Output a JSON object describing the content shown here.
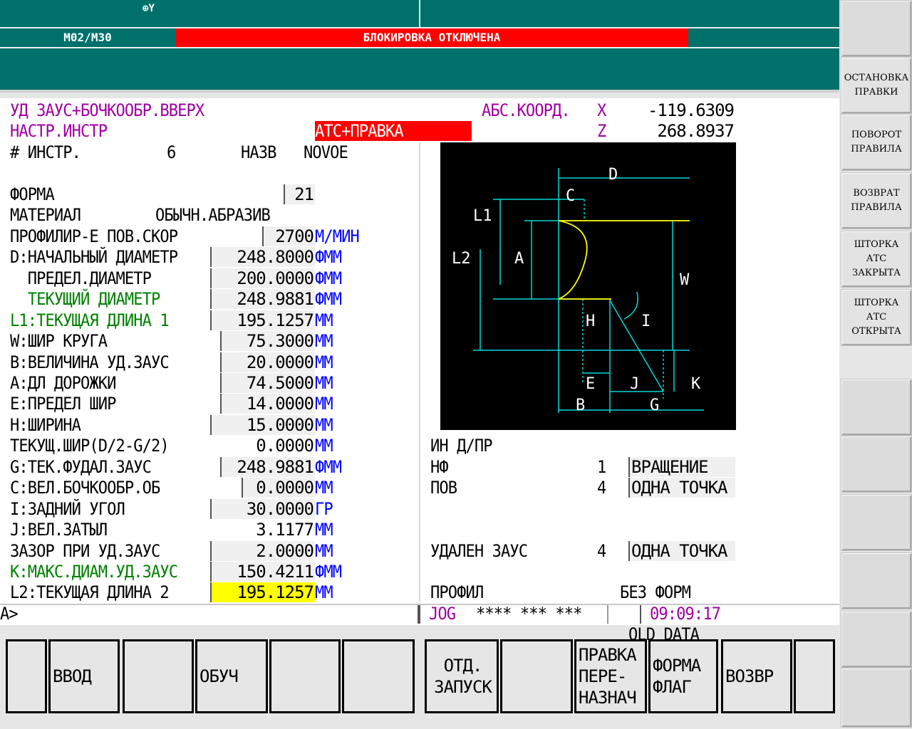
{
  "header": {
    "axis_indicator": "Y",
    "mode": "M02/M30",
    "lock_status": "БЛОКИРОВКА ОТКЛЮЧЕНА"
  },
  "info": {
    "line1": "УД ЗАУС+БОЧКООБР.ВВЕРХ",
    "line2": "НАСТР.ИНСТР",
    "mode_tag": "АТС+ПРАВКА",
    "coord_label": "АБС.КООРД.",
    "x_label": "X",
    "x_value": "-119.6309",
    "z_label": "Z",
    "z_value": "268.8937"
  },
  "tool": {
    "num_label": "# ИНСТР.",
    "num_value": "6",
    "name_label": "НАЗВ",
    "name_value": "NOVOE"
  },
  "params": [
    {
      "label": "ФОРМА",
      "value": "21",
      "unit": ""
    },
    {
      "label": "МАТЕРИАЛ",
      "value": "ОБЫЧН.АБРАЗИВ",
      "unit": ""
    },
    {
      "label": "ПРОФИЛИР-Е ПОВ.СКОР",
      "value": "2700",
      "unit": "М/МИН"
    },
    {
      "label": "D:НАЧАЛЬНЫЙ ДИАМЕТР",
      "value": "248.8000",
      "unit": "ФММ"
    },
    {
      "label": "  ПРЕДЕЛ.ДИАМЕТР",
      "value": "200.0000",
      "unit": "ФММ"
    },
    {
      "label": "  ТЕКУЩИЙ ДИАМЕТР",
      "value": "248.9881",
      "unit": "ФММ"
    },
    {
      "label": "L1:ТЕКУЩАЯ ДЛИНА 1",
      "value": "195.1257",
      "unit": "ММ"
    },
    {
      "label": "W:ШИР КРУГА",
      "value": "75.3000",
      "unit": "ММ"
    },
    {
      "label": "B:ВЕЛИЧИНА УД.ЗАУС",
      "value": "20.0000",
      "unit": "ММ"
    },
    {
      "label": "A:ДЛ ДОРОЖКИ",
      "value": "74.5000",
      "unit": "ММ"
    },
    {
      "label": "E:ПРЕДЕЛ ШИР",
      "value": "14.0000",
      "unit": "ММ"
    },
    {
      "label": "H:ШИРИНА",
      "value": "15.0000",
      "unit": "ММ"
    },
    {
      "label": "ТЕКУЩ.ШИР(D/2-G/2)",
      "value": "0.0000",
      "unit": "ММ"
    },
    {
      "label": "G:ТЕК.ФУДАЛ.ЗАУС",
      "value": "248.9881",
      "unit": "ФММ"
    },
    {
      "label": "C:ВЕЛ.БОЧКООБР.ОБ",
      "value": "0.0000",
      "unit": "ММ"
    },
    {
      "label": "I:ЗАДНИЙ УГОЛ",
      "value": "30.0000",
      "unit": "ГР"
    },
    {
      "label": "J:ВЕЛ.ЗАТЫЛ",
      "value": "3.1177",
      "unit": "ММ"
    },
    {
      "label": "ЗАЗОР ПРИ УД.ЗАУС",
      "value": "2.0000",
      "unit": "ММ"
    },
    {
      "label": "K:МАКС.ДИАМ.УД.ЗАУС",
      "value": "150.4211",
      "unit": "ФММ"
    },
    {
      "label": "L2:ТЕКУЩАЯ ДЛИНА 2",
      "value": "195.1257",
      "unit": "ММ"
    }
  ],
  "diagram": {
    "labels": [
      "D",
      "C",
      "L1",
      "L2",
      "A",
      "W",
      "H",
      "I",
      "E",
      "J",
      "K",
      "B",
      "G"
    ]
  },
  "right_info": {
    "title": "ИН Д/ПР",
    "rows": [
      {
        "label": "НФ",
        "num": "1",
        "value": "ВРАЩЕНИЕ"
      },
      {
        "label": "ПОВ",
        "num": "4",
        "value": "ОДНА ТОЧКА"
      },
      {
        "label": "УДАЛЕН ЗАУС",
        "num": "4",
        "value": "ОДНА ТОЧКА"
      }
    ],
    "profile_label": "ПРОФИЛ",
    "profile_value": "БЕЗ ФОРМ"
  },
  "status": {
    "prompt": "A>",
    "mode": "JOG",
    "stars": "**** *** ***",
    "time": "09:09:17",
    "old_data": "OLD DATA"
  },
  "softkeys": [
    "",
    "ВВОД",
    "",
    "ОБУЧ",
    "",
    "",
    "ОТД.\nЗАПУСК",
    "",
    "ПРАВКА\nПЕРЕ-\nНАЗНАЧ",
    "ФОРМА\nФЛАГ",
    "ВОЗВР",
    ""
  ],
  "side_keys": [
    "",
    "ОСТАНОВКА\nПРАВКИ",
    "ПОВОРОТ\nПРАВИЛА",
    "ВОЗВРАТ\nПРАВИЛА",
    "ШТОРКА\nАТС\nЗАКРЫТА",
    "ШТОРКА\nАТС\nОТКРЫТА",
    "",
    "",
    "",
    "",
    "",
    ""
  ]
}
